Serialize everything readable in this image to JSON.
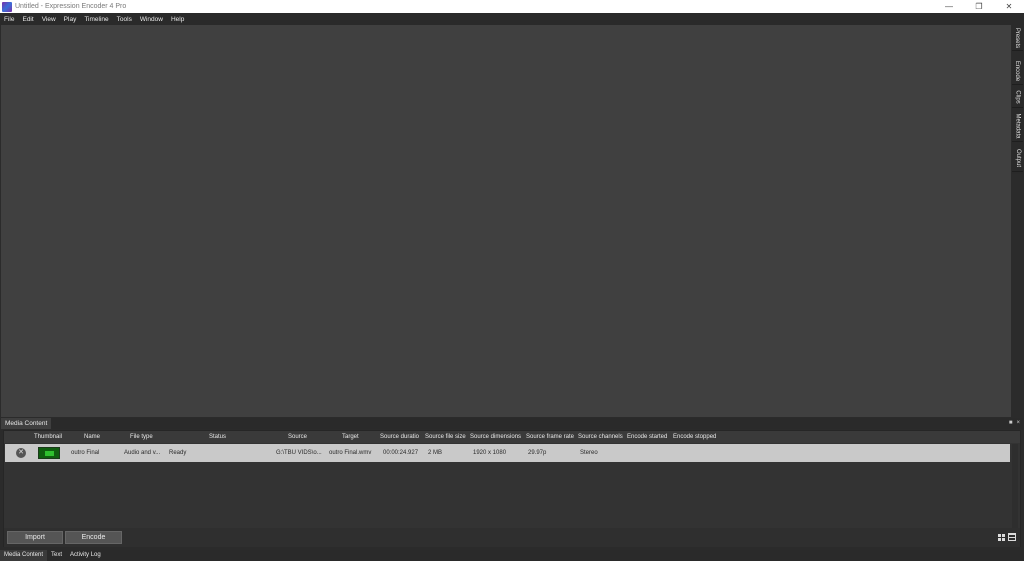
{
  "window": {
    "title": "Untitled - Expression Encoder 4 Pro",
    "minimize_label": "—",
    "maximize_label": "❐",
    "close_label": "✕"
  },
  "menu": [
    "File",
    "Edit",
    "View",
    "Play",
    "Timeline",
    "Tools",
    "Window",
    "Help"
  ],
  "side_tabs": [
    "Presets",
    "Encode",
    "Clips",
    "Metadata",
    "Output"
  ],
  "media_panel": {
    "title": "Media Content",
    "pin_label": "■",
    "close_label": "×",
    "columns": [
      "Thumbnail",
      "Name",
      "File type",
      "Status",
      "Source",
      "Target",
      "Source duratio",
      "Source file size",
      "Source dimensions",
      "Source frame rate",
      "Source channels",
      "Encode started",
      "Encode stopped"
    ],
    "rows": [
      {
        "remove_label": "✕",
        "name": "outro Final",
        "file_type": "Audio and v...",
        "status": "Ready",
        "source": "G:\\TBU VIDS\\o...",
        "target": "outro Final.wmv",
        "source_duration": "00:00:24.927",
        "source_file_size": "2 MB",
        "source_dimensions": "1920 x 1080",
        "source_frame_rate": "29.97p",
        "source_channels": "Stereo",
        "encode_started": "",
        "encode_stopped": ""
      }
    ],
    "import_label": "Import",
    "encode_label": "Encode"
  },
  "bottom_tabs": [
    "Media Content",
    "Text",
    "Activity Log"
  ]
}
